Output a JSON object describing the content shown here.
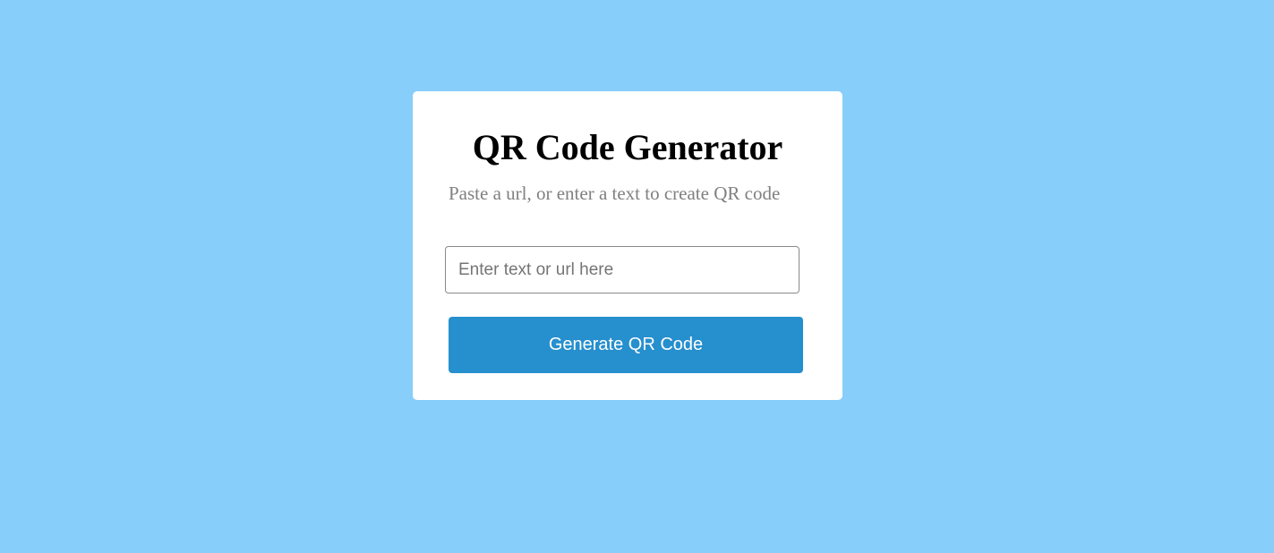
{
  "colors": {
    "background": "#87cefa",
    "card": "#ffffff",
    "button": "#268fce",
    "description_text": "#808080"
  },
  "card": {
    "title": "QR Code Generator",
    "description": "Paste a url, or enter a text to create QR code",
    "input": {
      "value": "",
      "placeholder": "Enter text or url here"
    },
    "generate_button_label": "Generate QR Code"
  }
}
